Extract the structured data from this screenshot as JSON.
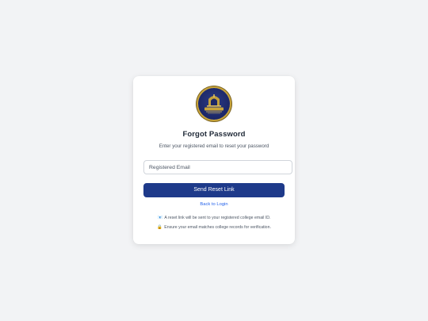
{
  "logo": {
    "text_line1": "ROYCHOWDHURY",
    "colors": {
      "navy": "#1c2766",
      "gold": "#c9a53a"
    }
  },
  "page": {
    "title": "Forgot Password",
    "subtitle": "Enter your registered email to reset your password"
  },
  "form": {
    "email_placeholder": "Registered Email",
    "email_value": "",
    "submit_label": "Send Reset Link"
  },
  "links": {
    "back_to_login": "Back to Login"
  },
  "notes": [
    {
      "icon": "envelope-icon",
      "glyph": "📧",
      "text": "A reset link will be sent to your registered college email ID."
    },
    {
      "icon": "lock-icon",
      "glyph": "🔒",
      "text": "Ensure your email matches college records for verification."
    }
  ],
  "colors": {
    "background": "#f2f3f5",
    "primary": "#1e3a8a",
    "link": "#2563eb"
  }
}
